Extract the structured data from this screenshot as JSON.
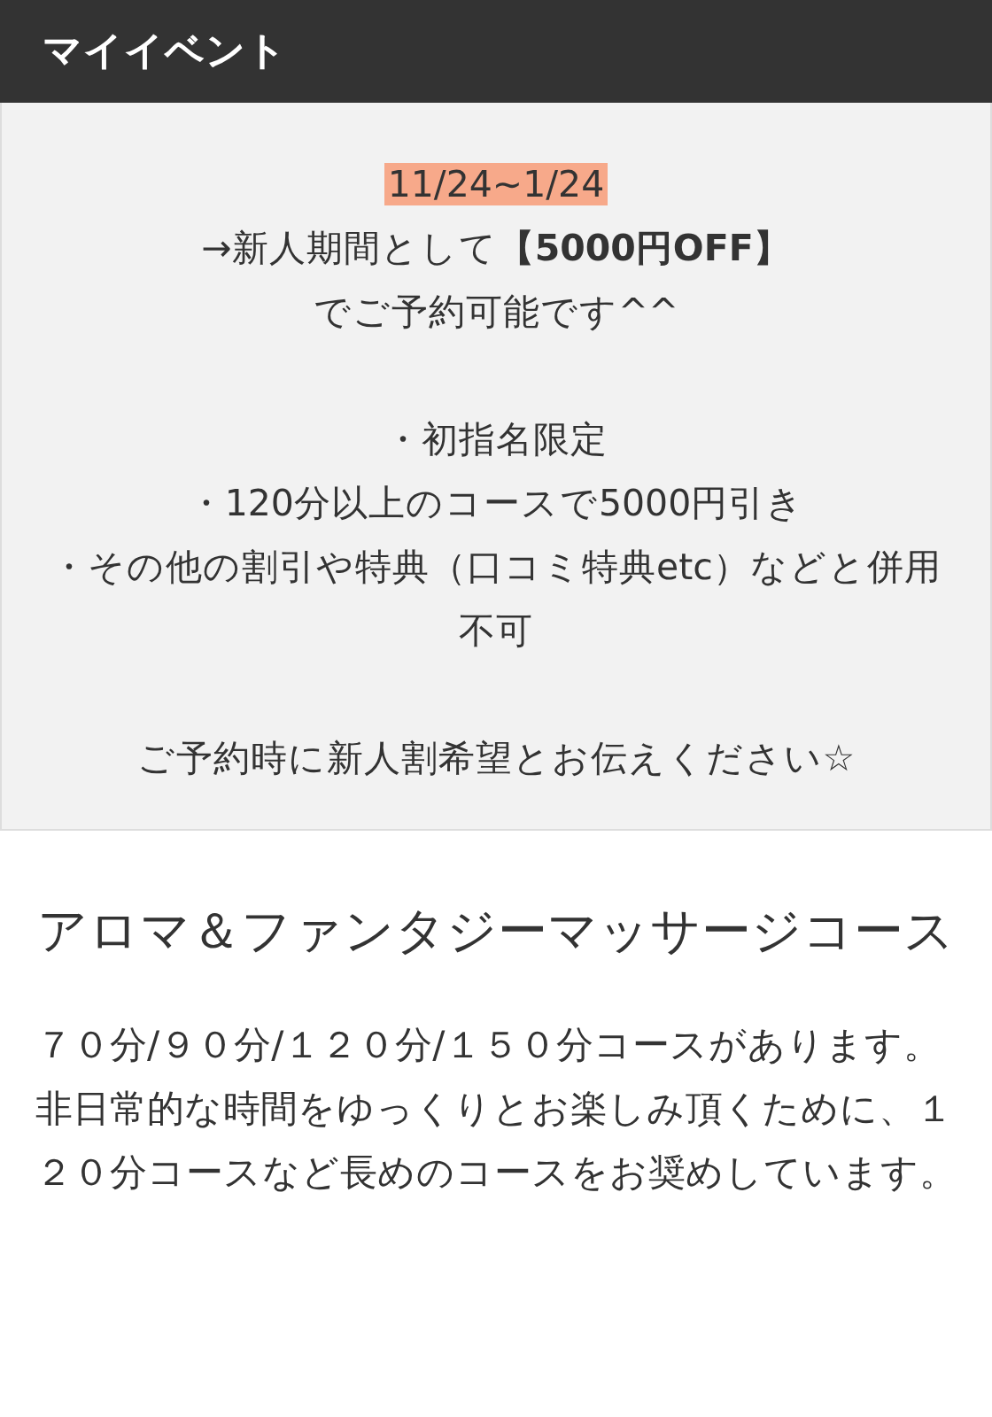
{
  "header": {
    "title": "マイイベント"
  },
  "event": {
    "date": "11/24~1/24",
    "groups": [
      [
        "→新人期間として**【5000円OFF】**",
        "でご予約可能です^^"
      ],
      [
        "・初指名限定",
        "・120分以上のコースで5000円引き",
        "・その他の割引や特典（口コミ特典etc）などと併用不可"
      ],
      [
        "ご予約時に新人割希望とお伝えください☆"
      ]
    ]
  },
  "course": {
    "title": "アロマ＆ファンタジーマッサージコース",
    "paragraphs": [
      "７０分/９０分/１２０分/１５０分コースがあります。",
      "非日常的な時間をゆっくりとお楽しみ頂くために、１２０分コースなど長めのコースをお奨めしています。"
    ]
  }
}
